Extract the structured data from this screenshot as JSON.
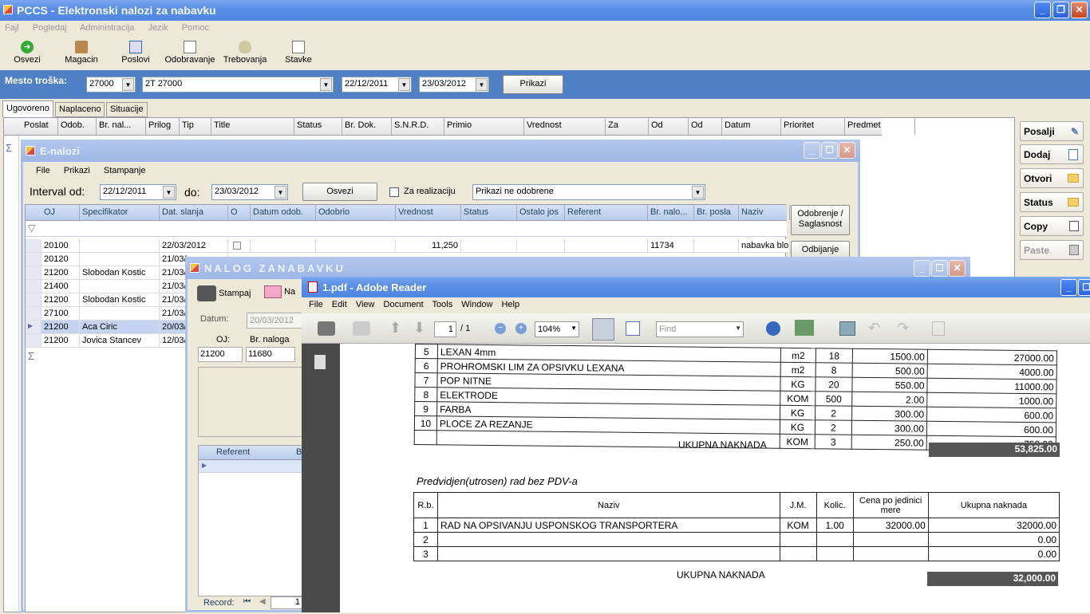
{
  "main_title": "PCCS - Elektronski nalozi za nabavku",
  "menu": [
    "Fajl",
    "Pogledaj",
    "Administracija",
    "Jezik",
    "Pomoc"
  ],
  "toolbar": [
    "Osvezi",
    "Magacin",
    "Poslovi",
    "Odobravanje",
    "Trebovanja",
    "Stavke"
  ],
  "filter": {
    "label": "Mesto troška:",
    "code": "27000",
    "name": "2T 27000",
    "from": "22/12/2011",
    "to": "23/03/2012",
    "button": "Prikazi"
  },
  "tabs": [
    "Ugovoreno",
    "Naplaceno",
    "Situacije"
  ],
  "main_cols": [
    "Poslat",
    "Odob.",
    "Br. nal...",
    "Prilog",
    "Tip",
    "Title",
    "Status",
    "Br. Dok.",
    "S.N.R.D.",
    "Primio",
    "Vrednost",
    "Za",
    "Od",
    "Od",
    "Datum",
    "Prioritet",
    "Predmet"
  ],
  "side_buttons": [
    "Posalji",
    "Dodaj",
    "Otvori",
    "Status",
    "Copy",
    "Paste"
  ],
  "enalozi": {
    "title": "E-nalozi",
    "menu": [
      "File",
      "Prikazi",
      "Stampanje"
    ],
    "interval_label": "Interval od:",
    "from": "22/12/2011",
    "do_label": "do:",
    "to": "23/03/2012",
    "refresh": "Osvezi",
    "za_realizaciju": "Za realizaciju",
    "filter": "Prikazi ne odobrene",
    "cols": [
      "OJ",
      "Specifikator",
      "Dat. slanja",
      "O",
      "Datum odob.",
      "Odobrio",
      "Vrednost",
      "Status",
      "Ostalo jos",
      "Referent",
      "Br. nalo...",
      "Br. posla",
      "Naziv"
    ],
    "rows": [
      [
        "20100",
        "",
        "22/03/2012",
        "",
        "",
        "",
        "11,250",
        "",
        "",
        "",
        "11734",
        "",
        "nabavka blo"
      ],
      [
        "20120",
        "",
        "21/03/"
      ],
      [
        "21200",
        "Slobodan Kostic",
        "21/03/"
      ],
      [
        "21400",
        "",
        "21/03/"
      ],
      [
        "21200",
        "Slobodan Kostic",
        "21/03/"
      ],
      [
        "27100",
        "",
        "21/03/"
      ],
      [
        "21200",
        "Aca Ciric",
        "20/03/"
      ],
      [
        "21200",
        "Jovica Stancev",
        "12/03/"
      ]
    ],
    "approve": "Odobrenje / Saglasnost",
    "reject": "Odbijanje"
  },
  "nalog": {
    "title": "NALOG ZANABAVKU",
    "print": "Stampaj",
    "na": "Na",
    "datum_label": "Datum:",
    "datum": "20/03/2012",
    "oj_label": "OJ:",
    "oj": "21200",
    "br_label": "Br. naloga",
    "br": "11680",
    "referent_col": "Referent",
    "b_col": "B",
    "record_label": "Record:",
    "record_val": "1"
  },
  "pdf": {
    "title": "1.pdf - Adobe Reader",
    "menu": [
      "File",
      "Edit",
      "View",
      "Document",
      "Tools",
      "Window",
      "Help"
    ],
    "page": "1",
    "pages": "/ 1",
    "zoom": "104%",
    "find": "Find",
    "table1": [
      [
        "5",
        "LEXAN 4mm",
        "m2",
        "18",
        "1500.00",
        "27000.00"
      ],
      [
        "6",
        "PROHROMSKI LIM ZA OPSIVKU LEXANA",
        "m2",
        "8",
        "500.00",
        "4000.00"
      ],
      [
        "7",
        "POP NITNE",
        "KG",
        "20",
        "550.00",
        "11000.00"
      ],
      [
        "8",
        "ELEKTRODE",
        "KOM",
        "500",
        "2.00",
        "1000.00"
      ],
      [
        "9",
        "FARBA",
        "KG",
        "2",
        "300.00",
        "600.00"
      ],
      [
        "10",
        "PLOCE ZA REZANJE",
        "KG",
        "2",
        "300.00",
        "600.00"
      ],
      [
        "",
        "",
        "KOM",
        "3",
        "250.00",
        "750.00"
      ]
    ],
    "total_label": "UKUPNA NAKNADA",
    "total1": "53,825.00",
    "section2": "Predvidjen(utrosen) rad bez PDV-a",
    "t2_head": [
      "R.b.",
      "Naziv",
      "J.M.",
      "Kolic.",
      "Cena po jedinici mere",
      "Ukupna naknada"
    ],
    "table2": [
      [
        "1",
        "RAD NA OPSIVANJU USPONSKOG TRANSPORTERA",
        "KOM",
        "1.00",
        "32000.00",
        "32000.00"
      ],
      [
        "2",
        "",
        "",
        "",
        "",
        "0.00"
      ],
      [
        "3",
        "",
        "",
        "",
        "",
        "0.00"
      ]
    ],
    "total2": "32,000.00"
  }
}
